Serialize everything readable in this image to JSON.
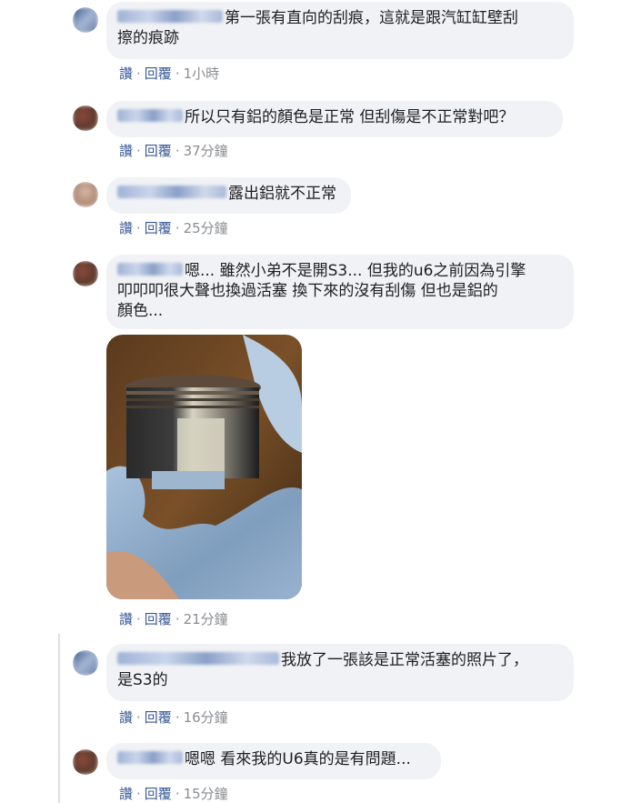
{
  "comments": [
    {
      "text": "第一張有直向的刮痕，這就是跟汽缸缸壁刮擦的痕跡",
      "line1": "第一張有直向的刮痕，這就是跟汽缸缸壁刮",
      "line2": "擦的痕跡",
      "like": "讚",
      "reply": "回覆",
      "time": "1小時"
    },
    {
      "text": "所以只有鋁的顏色是正常 但刮傷是不正常對吧？",
      "like": "讚",
      "reply": "回覆",
      "time": "37分鐘"
    },
    {
      "text": "露出鋁就不正常",
      "like": "讚",
      "reply": "回覆",
      "time": "25分鐘"
    },
    {
      "line1": "嗯... 雖然小弟不是開S3... 但我的u6之前因為引擎",
      "line2": "叩叩叩很大聲也換過活塞 換下來的沒有刮傷 但也是鋁的",
      "line3": "顏色...",
      "like": "讚",
      "reply": "回覆",
      "time": "21分鐘"
    },
    {
      "line1": "我放了一張該是正常活塞的照片了，",
      "line2": "是S3的",
      "like": "讚",
      "reply": "回覆",
      "time": "16分鐘"
    },
    {
      "text": "嗯嗯 看來我的U6真的是有問題...",
      "like": "讚",
      "reply": "回覆",
      "time": "15分鐘"
    }
  ],
  "separator": "·"
}
